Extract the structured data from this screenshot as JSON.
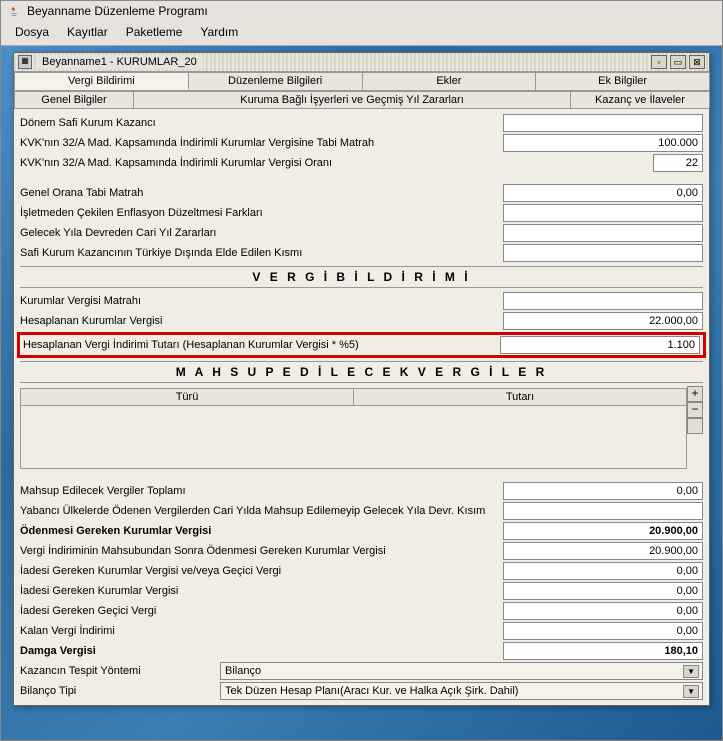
{
  "app": {
    "title": "Beyanname Düzenleme Programı"
  },
  "menu": {
    "file": "Dosya",
    "records": "Kayıtlar",
    "packaging": "Paketleme",
    "help": "Yardım"
  },
  "internal": {
    "title": "Beyanname1 - KURUMLAR_20"
  },
  "tabs1": {
    "t1": "Vergi Bildirimi",
    "t2": "Düzenleme Bilgileri",
    "t3": "Ekler",
    "t4": "Ek Bilgiler"
  },
  "tabs2": {
    "t1": "Genel Bilgiler",
    "t2": "Kuruma Bağlı İşyerleri ve Geçmiş Yıl Zararları",
    "t3": "Kazanç ve İlaveler"
  },
  "labels": {
    "donem": "Dönem Safi Kurum Kazancı",
    "kvk32a_matrah": "KVK'nın 32/A Mad. Kapsamında İndirimli Kurumlar Vergisine Tabi Matrah",
    "kvk32a_oran": "KVK'nın 32/A Mad. Kapsamında İndirimli Kurumlar Vergisi Oranı",
    "genel_oran": "Genel Orana Tabi Matrah",
    "isletmeden": "İşletmeden Çekilen Enflasyon Düzeltmesi Farkları",
    "gelecek_yila": "Gelecek Yıla Devreden Cari Yıl Zararları",
    "safi_kurum": "Safi Kurum Kazancının Türkiye Dışında Elde Edilen Kısmı",
    "kurumlar_matrah": "Kurumlar Vergisi Matrahı",
    "hesaplanan_kv": "Hesaplanan Kurumlar Vergisi",
    "hesaplanan_indirim": "Hesaplanan Vergi İndirimi Tutarı (Hesaplanan Kurumlar Vergisi * %5)",
    "mahsup_toplam": "Mahsup Edilecek Vergiler Toplamı",
    "yabanci": "Yabancı Ülkelerde Ödenen Vergilerden Cari Yılda Mahsup Edilemeyip Gelecek Yıla Devr. Kısım",
    "odenmesi_gereken": "Ödenmesi Gereken Kurumlar Vergisi",
    "vergi_indirim_sonra": "Vergi İndiriminin Mahsubundan Sonra Ödenmesi Gereken Kurumlar Vergisi",
    "iadesi_gecici": "İadesi Gereken Kurumlar Vergisi ve/veya Geçici Vergi",
    "iadesi_kv": "İadesi Gereken Kurumlar Vergisi",
    "iadesi_gecici2": "İadesi Gereken Geçici Vergi",
    "kalan_indirim": "Kalan Vergi İndirimi",
    "damga": "Damga Vergisi",
    "kazanc_tespit": "Kazancın Tespit Yöntemi",
    "bilanco_tipi": "Bilanço Tipi"
  },
  "sections": {
    "vergi_bildirimi": "V E R G İ   B İ L D İ R İ M İ",
    "mahsup": "M A H S U P   E D İ L E C E K   V E R G İ L E R"
  },
  "table": {
    "col1": "Türü",
    "col2": "Tutarı"
  },
  "values": {
    "kvk32a_matrah": "100.000",
    "kvk32a_oran": "22",
    "genel_oran": "0,00",
    "hesaplanan_kv": "22.000,00",
    "hesaplanan_indirim": "1.100",
    "mahsup_toplam": "0,00",
    "odenmesi_gereken": "20.900,00",
    "vergi_indirim_sonra": "20.900,00",
    "iadesi_gecici": "0,00",
    "iadesi_kv": "0,00",
    "iadesi_gecici2": "0,00",
    "kalan_indirim": "0,00",
    "damga": "180,10",
    "kazanc_tespit": "Bilanço",
    "bilanco_tipi": "Tek Düzen Hesap Planı(Aracı Kur. ve Halka Açık Şirk. Dahil)"
  }
}
